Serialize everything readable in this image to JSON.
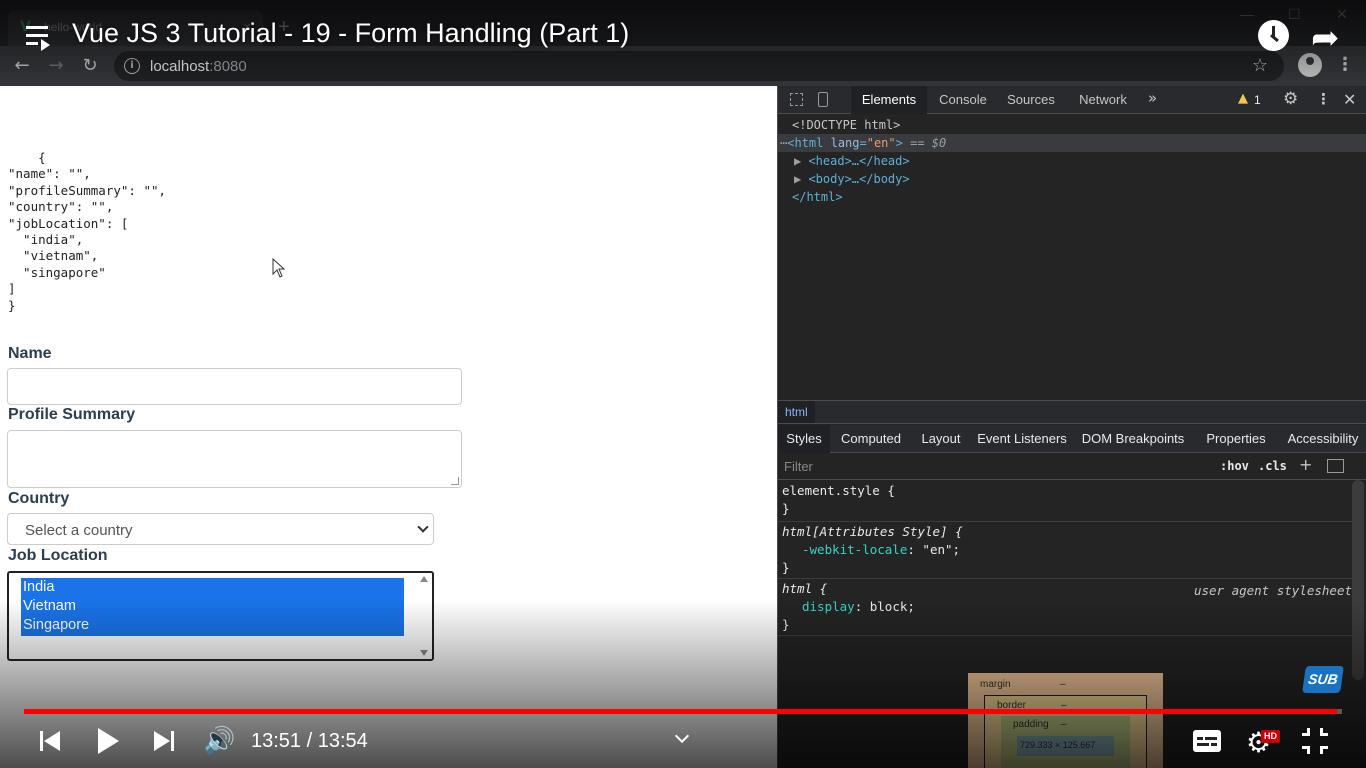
{
  "browser": {
    "tab_title": "hello-world",
    "tab_favicon": "vue-logo-icon",
    "url_host": "localhost",
    "url_port": ":8080",
    "new_tab": "+",
    "tab_close": "×"
  },
  "video": {
    "title": "Vue JS 3 Tutorial - 19 - Form Handling (Part 1)",
    "time_display": "13:51 / 13:54",
    "progress": 0.9964,
    "sub_badge": "SUB",
    "hd_badge": "HD"
  },
  "page": {
    "json_output": "    {\n\"name\": \"\",\n\"profileSummary\": \"\",\n\"country\": \"\",\n\"jobLocation\": [\n  \"india\",\n  \"vietnam\",\n  \"singapore\"\n]\n}",
    "labels": {
      "name": "Name",
      "profile_summary": "Profile Summary",
      "country": "Country",
      "job_location": "Job Location"
    },
    "country_select_value": "Select a country",
    "job_options": [
      "India",
      "Vietnam",
      "Singapore"
    ]
  },
  "devtools": {
    "tabs": [
      "Elements",
      "Console",
      "Sources",
      "Network"
    ],
    "more_tabs": "»",
    "warning_count": "1",
    "dom": {
      "doctype": "<!DOCTYPE html>",
      "html_open_prefix": "<html ",
      "html_attr_name": "lang",
      "html_attr_value": "\"en\"",
      "html_open_suffix": ">",
      "selected_marker": " == $0",
      "head": "<head>…</head>",
      "body": "<body>…</body>",
      "html_close": "</html>"
    },
    "breadcrumb": "html",
    "sub_tabs": [
      "Styles",
      "Computed",
      "Layout",
      "Event Listeners",
      "DOM Breakpoints",
      "Properties",
      "Accessibility"
    ],
    "filter_placeholder": "Filter",
    "hov": ":hov",
    "cls": ".cls",
    "rules": {
      "element_style_open": "element.style {",
      "close": "}",
      "attr_style_selector": "html[Attributes Style] {",
      "attr_style_prop": "-webkit-locale",
      "attr_style_value": "\"en\";",
      "ua_selector": "html {",
      "ua_source": "user agent stylesheet",
      "ua_prop": "display",
      "ua_value": "block;"
    },
    "box_model": {
      "margin": "margin",
      "border": "border",
      "padding": "padding",
      "dash": "–",
      "content": "729.333 × 125.667"
    }
  },
  "colors": {
    "progress": "#ff0000",
    "selection": "#1a73e8",
    "label": "#2c3e50"
  }
}
